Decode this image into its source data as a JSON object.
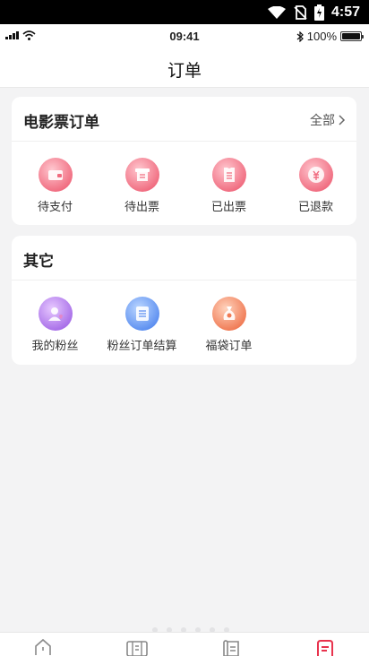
{
  "android_status": {
    "time": "4:57"
  },
  "ios_status": {
    "time": "09:41",
    "battery": "100%"
  },
  "header": {
    "title": "订单"
  },
  "movie_orders": {
    "title": "电影票订单",
    "all_label": "全部",
    "items": [
      {
        "label": "待支付",
        "icon": "wallet-icon"
      },
      {
        "label": "待出票",
        "icon": "ticket-printing-icon"
      },
      {
        "label": "已出票",
        "icon": "ticket-issued-icon"
      },
      {
        "label": "已退款",
        "icon": "refund-icon"
      }
    ]
  },
  "other": {
    "title": "其它",
    "items": [
      {
        "label": "我的粉丝",
        "icon": "fans-icon"
      },
      {
        "label": "粉丝订单结算",
        "icon": "fan-settlement-icon"
      },
      {
        "label": "福袋订单",
        "icon": "lucky-bag-icon"
      }
    ]
  },
  "tabbar": {
    "tabs": [
      {
        "icon": "home-icon"
      },
      {
        "icon": "cinema-icon"
      },
      {
        "icon": "list-icon"
      },
      {
        "icon": "order-icon",
        "active": true
      }
    ]
  },
  "colors": {
    "accent": "#e8344e",
    "background": "#f3f3f4"
  }
}
